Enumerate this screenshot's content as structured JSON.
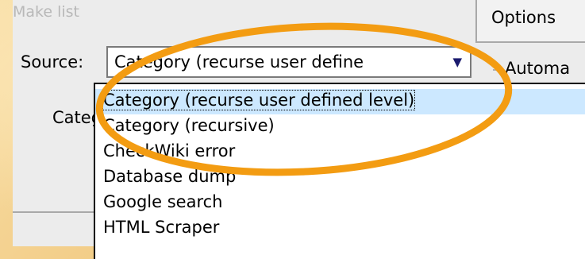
{
  "window": {
    "group_title": "Make list",
    "source_label": "Source:",
    "combo_value": "Category (recurse user define",
    "category_label": "Categ"
  },
  "tabs": [
    {
      "label": "Options"
    }
  ],
  "options_panel": {
    "auto_label": "Automa"
  },
  "dropdown": {
    "options": [
      {
        "label": "Category (recurse user defined level)",
        "selected": true
      },
      {
        "label": "Category (recursive)",
        "selected": false
      },
      {
        "label": "CheckWiki error",
        "selected": false
      },
      {
        "label": "Database dump",
        "selected": false
      },
      {
        "label": "Google search",
        "selected": false
      },
      {
        "label": "HTML Scraper",
        "selected": false
      }
    ]
  },
  "annotation": {
    "color": "#f39c12"
  }
}
